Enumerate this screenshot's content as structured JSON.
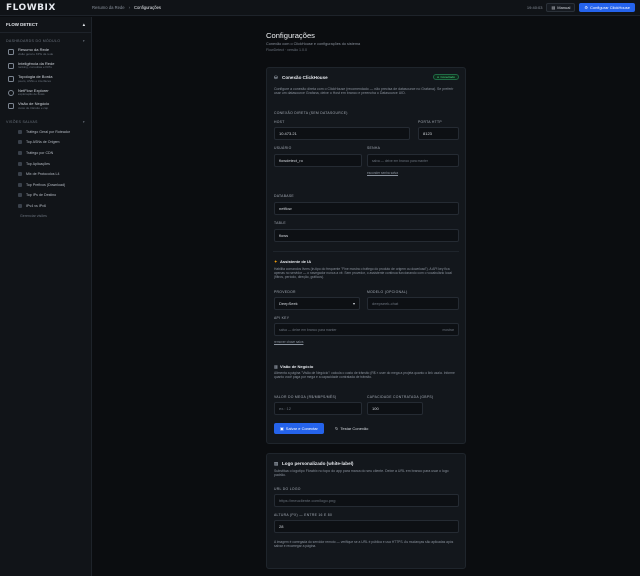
{
  "app": {
    "logo_text": "FLOWBIX"
  },
  "breadcrumb": {
    "parent": "Resumo da Rede",
    "sep": "›",
    "current": "Configurações"
  },
  "topbar": {
    "time": "19:40:03",
    "manual_label": "Manual",
    "config_label": "Configurar ClickHouse"
  },
  "sidebar": {
    "title": "FLOW DETECT",
    "section1": "DASHBOARDS DO MÓDULO",
    "items": [
      {
        "title": "Resumo da Rede",
        "sub": "visão geral e KPIs da rede"
      },
      {
        "title": "Inteligência da Rede",
        "sub": "ranking, consultas e KPIs"
      },
      {
        "title": "Topologia de Borda",
        "sub": "peers, ASNs e interfaces"
      },
      {
        "title": "NetFlow Explorer",
        "sub": "exploração de flows"
      },
      {
        "title": "Visão de Negócio",
        "sub": "custo de trânsito e cap"
      }
    ],
    "section2": "VISÕES SALVAS",
    "saved": [
      "Tráfego Geral por Roteador",
      "Top ASNs de Origem",
      "Tráfego por CDN",
      "Top Aplicações",
      "Mix de Protocolos L4",
      "Top Prefixos (Download)",
      "Top IPs de Destino",
      "IPv4 vs IPv6"
    ],
    "manage": "Gerenciar visões"
  },
  "page": {
    "title": "Configurações",
    "subtitle": "Conexão com o ClickHouse e configurações do sistema",
    "version": "FlowDetect · versão 1.0.0"
  },
  "clickhouse": {
    "title": "Conexão ClickHouse",
    "badge": "Conectado",
    "desc": "Configure a conexão direta com o ClickHouse (recomendado — não precisa de datasource no Grafana). Se preferir usar um datasource Grafana, deixe o Host em branco e preencha o Datasource UID.",
    "direct_label": "CONEXÃO DIRETA (SEM DATASOURCE)",
    "host_label": "HOST",
    "host_value": "10.473.21",
    "port_label": "PORTA HTTP",
    "port_value": "8123",
    "user_label": "USUÁRIO",
    "user_value": "flowdetect_ro",
    "pass_label": "SENHA",
    "pass_placeholder": "salva — deixe em branco para manter",
    "reveal": "esconder senha salva",
    "db_label": "DATABASE",
    "db_value": "netflow",
    "table_label": "TABLE",
    "table_value": "flows"
  },
  "ai": {
    "title": "Assistente de IA",
    "desc": "Habilita comandos livres (in-tipo do frequente \"Fine mostra o tráfego do produto de origem ou download\"). A API key fica apenas no servidor — o navegador nunca a vê. Sem provedor, o assistente continua funcionando com o vocabulário local (filtros, período, direção, gráficos).",
    "provider_label": "PROVEDOR",
    "provider_value": "DeepSeek",
    "model_label": "MODELO (OPCIONAL)",
    "model_placeholder": "deepseek-chat",
    "key_label": "API KEY",
    "key_placeholder": "salva — deixe em branco para manter",
    "key_show": "mostrar",
    "remove": "remover chave salva"
  },
  "business": {
    "title": "Visão de Negócio",
    "desc": "Alimenta a página \"Visão de Negócio\": calcula o custo de trânsito (R$ × user do mega a projeta quanto o link usa/a. Informe quanto você paga por mega e a capacidade contratada de trânsito.",
    "price_label": "VALOR DO MEGA (R$/MBPS/MÊS)",
    "price_placeholder": "ex.: 12",
    "cap_label": "CAPACIDADE CONTRATADA (GBPS)",
    "cap_value": "100"
  },
  "actions": {
    "save": "Salvar e Conectar",
    "test": "Testar Conexão"
  },
  "logo": {
    "title": "Logo personalizado (white-label)",
    "desc": "Substitua o logotipo Flowbix no topo do app para marca do seu cliente. Deixe a URL em branco para usar o logo padrão.",
    "url_label": "URL DO LOGO",
    "url_placeholder": "https://meucliente.com/logo.png",
    "height_label": "ALTURA (PX) — ENTRE 16 E 80",
    "height_value": "28",
    "note": "A imagem é carregada do servidor remoto — verifique se a URL é pública e usa HTTPS. As mudanças são aplicadas após salvar e recarregar a página."
  }
}
